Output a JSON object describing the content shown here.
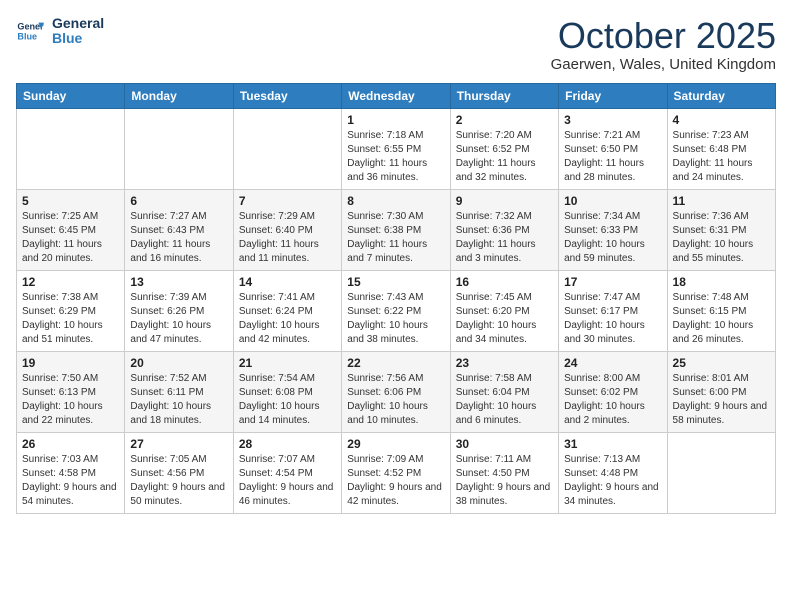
{
  "header": {
    "logo_line1": "General",
    "logo_line2": "Blue",
    "title": "October 2025",
    "subtitle": "Gaerwen, Wales, United Kingdom"
  },
  "weekdays": [
    "Sunday",
    "Monday",
    "Tuesday",
    "Wednesday",
    "Thursday",
    "Friday",
    "Saturday"
  ],
  "weeks": [
    [
      {
        "day": "",
        "sunrise": "",
        "sunset": "",
        "daylight": ""
      },
      {
        "day": "",
        "sunrise": "",
        "sunset": "",
        "daylight": ""
      },
      {
        "day": "",
        "sunrise": "",
        "sunset": "",
        "daylight": ""
      },
      {
        "day": "1",
        "sunrise": "Sunrise: 7:18 AM",
        "sunset": "Sunset: 6:55 PM",
        "daylight": "Daylight: 11 hours and 36 minutes."
      },
      {
        "day": "2",
        "sunrise": "Sunrise: 7:20 AM",
        "sunset": "Sunset: 6:52 PM",
        "daylight": "Daylight: 11 hours and 32 minutes."
      },
      {
        "day": "3",
        "sunrise": "Sunrise: 7:21 AM",
        "sunset": "Sunset: 6:50 PM",
        "daylight": "Daylight: 11 hours and 28 minutes."
      },
      {
        "day": "4",
        "sunrise": "Sunrise: 7:23 AM",
        "sunset": "Sunset: 6:48 PM",
        "daylight": "Daylight: 11 hours and 24 minutes."
      }
    ],
    [
      {
        "day": "5",
        "sunrise": "Sunrise: 7:25 AM",
        "sunset": "Sunset: 6:45 PM",
        "daylight": "Daylight: 11 hours and 20 minutes."
      },
      {
        "day": "6",
        "sunrise": "Sunrise: 7:27 AM",
        "sunset": "Sunset: 6:43 PM",
        "daylight": "Daylight: 11 hours and 16 minutes."
      },
      {
        "day": "7",
        "sunrise": "Sunrise: 7:29 AM",
        "sunset": "Sunset: 6:40 PM",
        "daylight": "Daylight: 11 hours and 11 minutes."
      },
      {
        "day": "8",
        "sunrise": "Sunrise: 7:30 AM",
        "sunset": "Sunset: 6:38 PM",
        "daylight": "Daylight: 11 hours and 7 minutes."
      },
      {
        "day": "9",
        "sunrise": "Sunrise: 7:32 AM",
        "sunset": "Sunset: 6:36 PM",
        "daylight": "Daylight: 11 hours and 3 minutes."
      },
      {
        "day": "10",
        "sunrise": "Sunrise: 7:34 AM",
        "sunset": "Sunset: 6:33 PM",
        "daylight": "Daylight: 10 hours and 59 minutes."
      },
      {
        "day": "11",
        "sunrise": "Sunrise: 7:36 AM",
        "sunset": "Sunset: 6:31 PM",
        "daylight": "Daylight: 10 hours and 55 minutes."
      }
    ],
    [
      {
        "day": "12",
        "sunrise": "Sunrise: 7:38 AM",
        "sunset": "Sunset: 6:29 PM",
        "daylight": "Daylight: 10 hours and 51 minutes."
      },
      {
        "day": "13",
        "sunrise": "Sunrise: 7:39 AM",
        "sunset": "Sunset: 6:26 PM",
        "daylight": "Daylight: 10 hours and 47 minutes."
      },
      {
        "day": "14",
        "sunrise": "Sunrise: 7:41 AM",
        "sunset": "Sunset: 6:24 PM",
        "daylight": "Daylight: 10 hours and 42 minutes."
      },
      {
        "day": "15",
        "sunrise": "Sunrise: 7:43 AM",
        "sunset": "Sunset: 6:22 PM",
        "daylight": "Daylight: 10 hours and 38 minutes."
      },
      {
        "day": "16",
        "sunrise": "Sunrise: 7:45 AM",
        "sunset": "Sunset: 6:20 PM",
        "daylight": "Daylight: 10 hours and 34 minutes."
      },
      {
        "day": "17",
        "sunrise": "Sunrise: 7:47 AM",
        "sunset": "Sunset: 6:17 PM",
        "daylight": "Daylight: 10 hours and 30 minutes."
      },
      {
        "day": "18",
        "sunrise": "Sunrise: 7:48 AM",
        "sunset": "Sunset: 6:15 PM",
        "daylight": "Daylight: 10 hours and 26 minutes."
      }
    ],
    [
      {
        "day": "19",
        "sunrise": "Sunrise: 7:50 AM",
        "sunset": "Sunset: 6:13 PM",
        "daylight": "Daylight: 10 hours and 22 minutes."
      },
      {
        "day": "20",
        "sunrise": "Sunrise: 7:52 AM",
        "sunset": "Sunset: 6:11 PM",
        "daylight": "Daylight: 10 hours and 18 minutes."
      },
      {
        "day": "21",
        "sunrise": "Sunrise: 7:54 AM",
        "sunset": "Sunset: 6:08 PM",
        "daylight": "Daylight: 10 hours and 14 minutes."
      },
      {
        "day": "22",
        "sunrise": "Sunrise: 7:56 AM",
        "sunset": "Sunset: 6:06 PM",
        "daylight": "Daylight: 10 hours and 10 minutes."
      },
      {
        "day": "23",
        "sunrise": "Sunrise: 7:58 AM",
        "sunset": "Sunset: 6:04 PM",
        "daylight": "Daylight: 10 hours and 6 minutes."
      },
      {
        "day": "24",
        "sunrise": "Sunrise: 8:00 AM",
        "sunset": "Sunset: 6:02 PM",
        "daylight": "Daylight: 10 hours and 2 minutes."
      },
      {
        "day": "25",
        "sunrise": "Sunrise: 8:01 AM",
        "sunset": "Sunset: 6:00 PM",
        "daylight": "Daylight: 9 hours and 58 minutes."
      }
    ],
    [
      {
        "day": "26",
        "sunrise": "Sunrise: 7:03 AM",
        "sunset": "Sunset: 4:58 PM",
        "daylight": "Daylight: 9 hours and 54 minutes."
      },
      {
        "day": "27",
        "sunrise": "Sunrise: 7:05 AM",
        "sunset": "Sunset: 4:56 PM",
        "daylight": "Daylight: 9 hours and 50 minutes."
      },
      {
        "day": "28",
        "sunrise": "Sunrise: 7:07 AM",
        "sunset": "Sunset: 4:54 PM",
        "daylight": "Daylight: 9 hours and 46 minutes."
      },
      {
        "day": "29",
        "sunrise": "Sunrise: 7:09 AM",
        "sunset": "Sunset: 4:52 PM",
        "daylight": "Daylight: 9 hours and 42 minutes."
      },
      {
        "day": "30",
        "sunrise": "Sunrise: 7:11 AM",
        "sunset": "Sunset: 4:50 PM",
        "daylight": "Daylight: 9 hours and 38 minutes."
      },
      {
        "day": "31",
        "sunrise": "Sunrise: 7:13 AM",
        "sunset": "Sunset: 4:48 PM",
        "daylight": "Daylight: 9 hours and 34 minutes."
      },
      {
        "day": "",
        "sunrise": "",
        "sunset": "",
        "daylight": ""
      }
    ]
  ]
}
